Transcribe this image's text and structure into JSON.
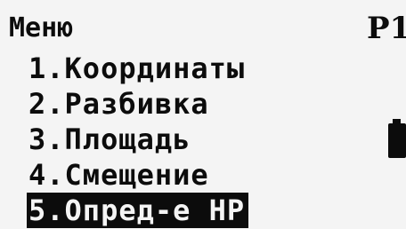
{
  "header": {
    "title": "Меню",
    "page": "P1"
  },
  "menu": {
    "items": [
      {
        "label": "1.Координаты"
      },
      {
        "label": "2.Разбивка"
      },
      {
        "label": "3.Площадь"
      },
      {
        "label": "4.Смещение"
      },
      {
        "label": "5.Опред-е НР"
      }
    ],
    "selected_index": 4
  },
  "status": {
    "battery_icon": "battery-icon"
  }
}
